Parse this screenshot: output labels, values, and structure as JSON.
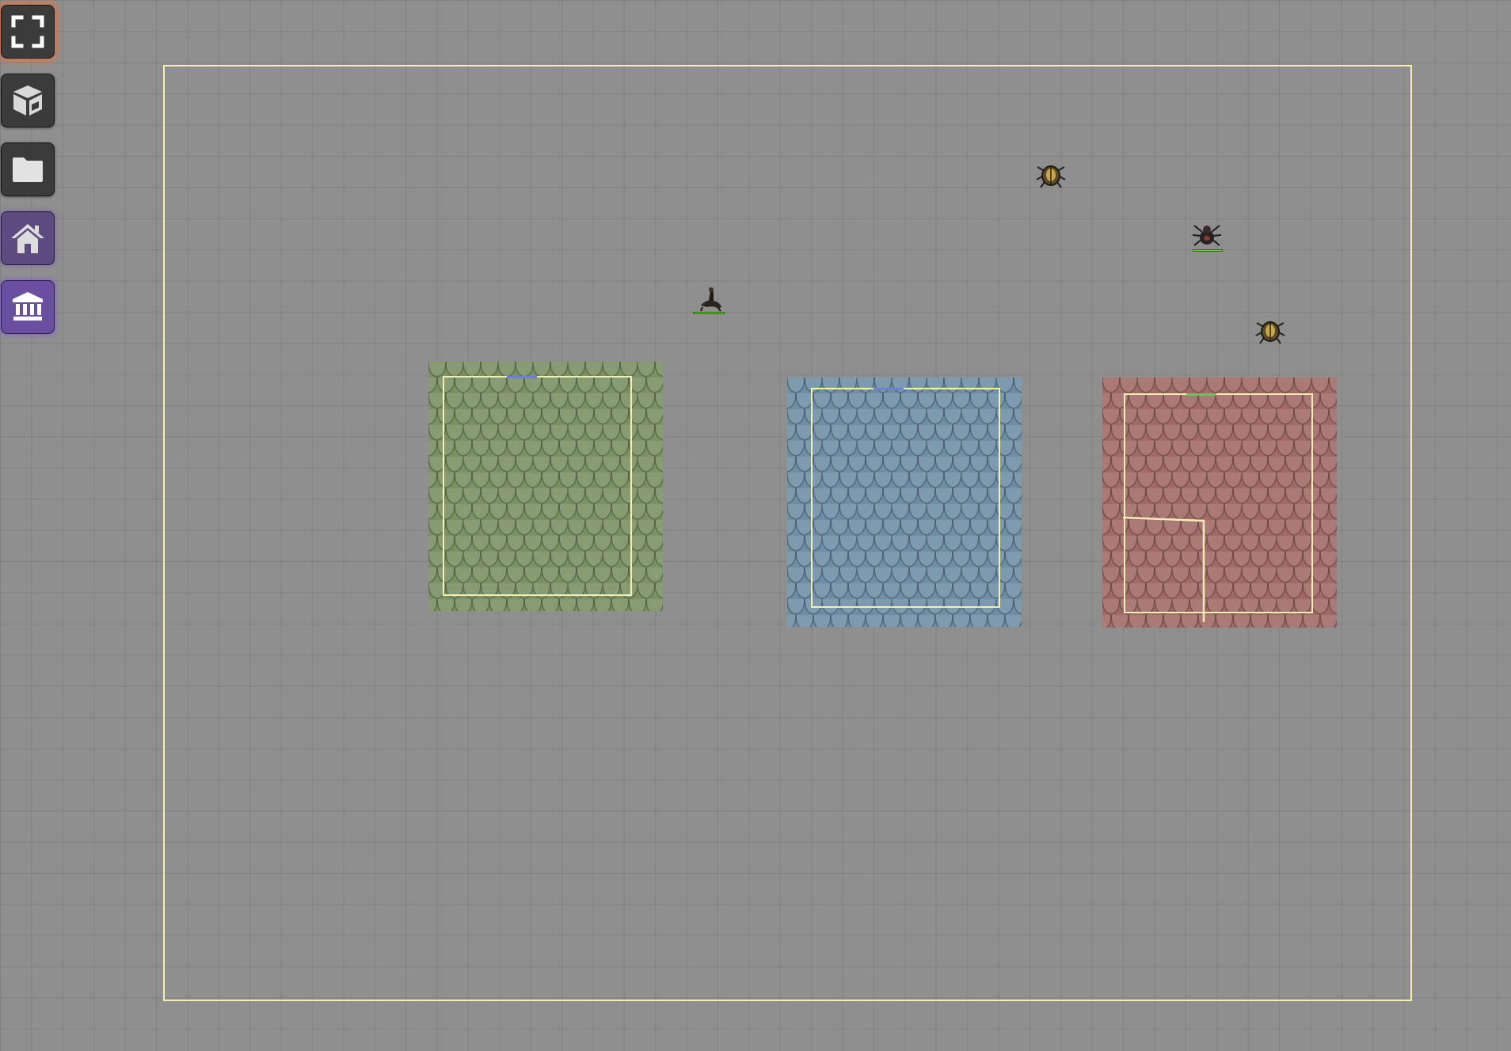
{
  "toolbar": {
    "buttons": [
      {
        "name": "fullscreen-button",
        "icon": "expand-icon",
        "state": "active"
      },
      {
        "name": "model-button",
        "icon": "cube-icon",
        "state": "normal"
      },
      {
        "name": "folder-button",
        "icon": "folder-icon",
        "state": "normal"
      },
      {
        "name": "home-button",
        "icon": "house-icon",
        "state": "normal"
      },
      {
        "name": "building-button",
        "icon": "landmark-icon",
        "state": "selected"
      }
    ],
    "colors": {
      "dark": "#3b3b3b",
      "purple": "#6a4ea0",
      "active_glow": "#e8703c"
    }
  },
  "scene": {
    "grid_color": "#8f8f8f",
    "bounds_color": "#f3efb4",
    "rooms": [
      {
        "name": "room-green",
        "roof_color": "#7a9164",
        "door_color": "#6e7fd6"
      },
      {
        "name": "room-blue",
        "roof_color": "#6e8ea6",
        "door_color": "#6e7fd6"
      },
      {
        "name": "room-red",
        "roof_color": "#a26a66",
        "door_color": "#6fbf64"
      }
    ],
    "tokens": [
      {
        "name": "spider-token",
        "kind": "spider-icon",
        "health": 1.0
      },
      {
        "name": "rider-token",
        "kind": "rider-icon",
        "health": 1.0
      },
      {
        "name": "beetle-token-1",
        "kind": "beetle-icon"
      },
      {
        "name": "beetle-token-2",
        "kind": "beetle-icon"
      }
    ]
  }
}
